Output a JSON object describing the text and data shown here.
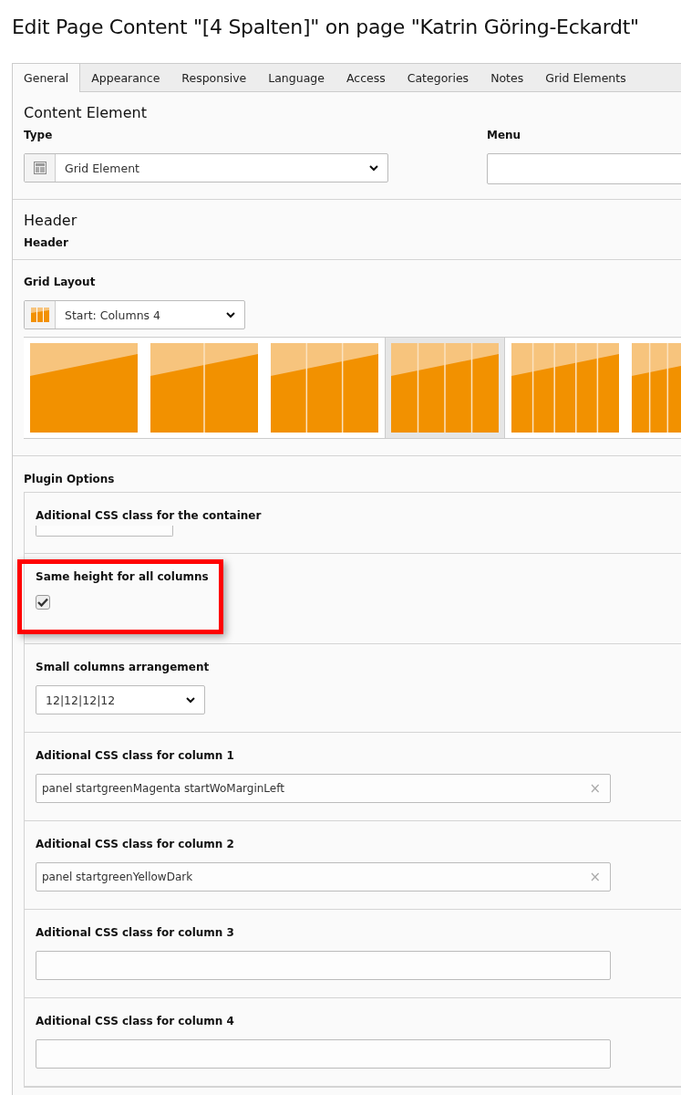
{
  "page_title": "Edit Page Content \"[4 Spalten]\" on page \"Katrin Göring-Eckardt\"",
  "tabs": [
    {
      "label": "General",
      "selected": true
    },
    {
      "label": "Appearance",
      "selected": false
    },
    {
      "label": "Responsive",
      "selected": false
    },
    {
      "label": "Language",
      "selected": false
    },
    {
      "label": "Access",
      "selected": false
    },
    {
      "label": "Categories",
      "selected": false
    },
    {
      "label": "Notes",
      "selected": false
    },
    {
      "label": "Grid Elements",
      "selected": false
    }
  ],
  "content_element": {
    "heading": "Content Element",
    "type": {
      "label": "Type",
      "value": "Grid Element"
    },
    "menu": {
      "label": "Menu"
    }
  },
  "header": {
    "heading": "Header",
    "field_label": "Header"
  },
  "grid_layout": {
    "label": "Grid Layout",
    "value": "Start: Columns 4",
    "layouts": [
      {
        "kind": "single",
        "selected": false
      },
      {
        "kind": "double",
        "selected": false
      },
      {
        "kind": "triple",
        "selected": false
      },
      {
        "kind": "quad",
        "selected": true
      },
      {
        "kind": "five",
        "selected": false
      },
      {
        "kind": "six",
        "selected": false
      }
    ]
  },
  "plugin_options": {
    "heading": "Plugin Options",
    "fields": [
      {
        "kind": "short-text",
        "label": "Aditional CSS class for the container"
      },
      {
        "kind": "checkbox",
        "label": "Same height for all columns",
        "checked": true,
        "highlighted": true
      },
      {
        "kind": "select",
        "label": "Small columns arrangement",
        "value": "12|12|12|12"
      },
      {
        "kind": "text",
        "label": "Aditional CSS class for column 1",
        "value": "panel startgreenMagenta startWoMarginLeft",
        "clear_icon": "×"
      },
      {
        "kind": "text",
        "label": "Aditional CSS class for column 2",
        "value": "panel startgreenYellowDark",
        "clear_icon": "×"
      },
      {
        "kind": "text",
        "label": "Aditional CSS class for column 3"
      },
      {
        "kind": "text",
        "label": "Aditional CSS class for column 4"
      }
    ]
  }
}
